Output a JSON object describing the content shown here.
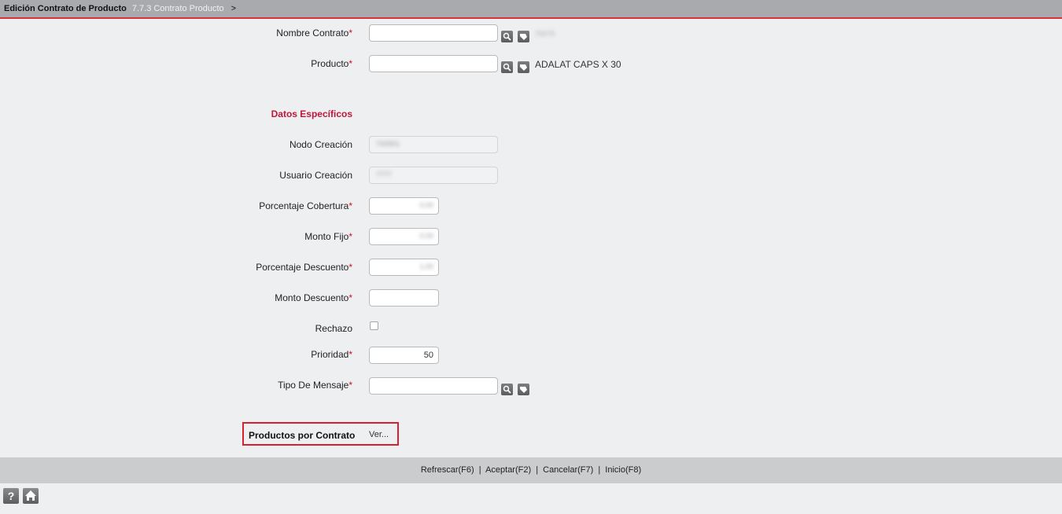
{
  "header": {
    "title": "Edición Contrato de Producto",
    "crumb": "7.7.3 Contrato Producto",
    "separator": ">"
  },
  "form": {
    "nombre_contrato": {
      "label": "Nombre Contrato",
      "required": "*",
      "value": "",
      "desc": "70079"
    },
    "producto": {
      "label": "Producto",
      "required": "*",
      "value": "",
      "desc": "ADALAT CAPS X 30"
    },
    "section_title": "Datos Específicos",
    "nodo_creacion": {
      "label": "Nodo Creación",
      "value": "700901"
    },
    "usuario_creacion": {
      "label": "Usuario Creación",
      "value": "7777"
    },
    "porcentaje_cobertura": {
      "label": "Porcentaje Cobertura",
      "required": "*",
      "value": "0,00"
    },
    "monto_fijo": {
      "label": "Monto Fijo",
      "required": "*",
      "value": "0,00"
    },
    "porcentaje_descuento": {
      "label": "Porcentaje Descuento",
      "required": "*",
      "value": "1,00"
    },
    "monto_descuento": {
      "label": "Monto Descuento",
      "required": "*",
      "value": ""
    },
    "rechazo": {
      "label": "Rechazo",
      "checked": false
    },
    "prioridad": {
      "label": "Prioridad",
      "required": "*",
      "value": "50"
    },
    "tipo_mensaje": {
      "label": "Tipo De Mensaje",
      "required": "*",
      "value": ""
    }
  },
  "productos_por_contrato": {
    "label": "Productos por Contrato",
    "link": "Ver..."
  },
  "footer": {
    "actions": [
      "Refrescar(F6)",
      "Aceptar(F2)",
      "Cancelar(F7)",
      "Inicio(F8)"
    ],
    "separator": "|"
  },
  "icons": {
    "search": "search-icon",
    "clear": "eraser-icon",
    "help": "help-icon",
    "home": "home-icon"
  },
  "colors": {
    "accent": "#d8323c",
    "section": "#c0163a",
    "required": "#c8102e"
  }
}
